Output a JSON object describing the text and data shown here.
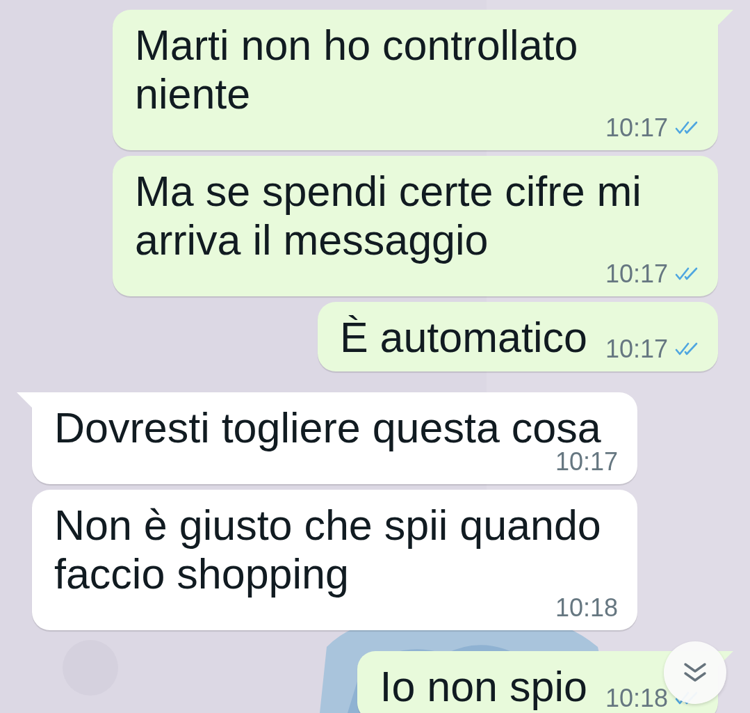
{
  "messages": [
    {
      "kind": "outgoing",
      "tail": true,
      "text": "Marti non ho controllato niente",
      "time": "10:17",
      "read": true
    },
    {
      "kind": "outgoing",
      "tail": false,
      "text": "Ma se spendi certe cifre mi arriva il messaggio",
      "time": "10:17",
      "read": true
    },
    {
      "kind": "outgoing",
      "tail": false,
      "text": "È automatico",
      "time": "10:17",
      "read": true
    },
    {
      "kind": "incoming",
      "tail": true,
      "text": "Dovresti togliere questa cosa",
      "time": "10:17"
    },
    {
      "kind": "incoming",
      "tail": false,
      "text": "Non è giusto che spii quando faccio shopping",
      "time": "10:18"
    },
    {
      "kind": "outgoing",
      "tail": true,
      "text": "Io non spio",
      "time": "10:18",
      "read": true
    }
  ]
}
